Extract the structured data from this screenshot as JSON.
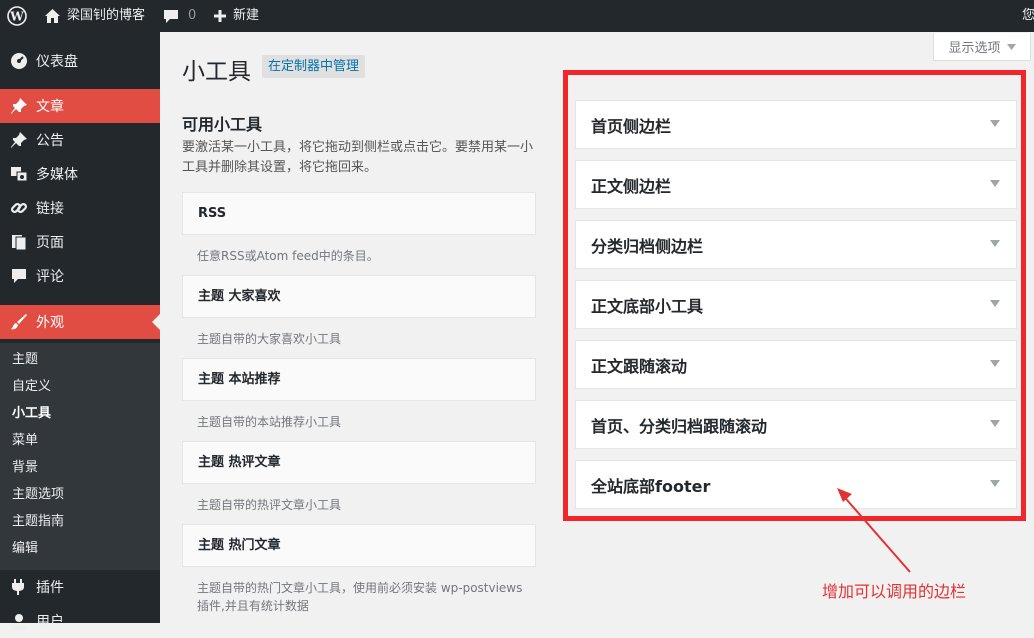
{
  "admin_bar": {
    "site_name": "梁国钊的博客",
    "comments_count": "0",
    "new_label": "新建",
    "user_partial": "您"
  },
  "sidebar": {
    "items": [
      {
        "label": "仪表盘",
        "icon": "dashboard-icon"
      },
      {
        "label": "文章",
        "icon": "pin-icon"
      },
      {
        "label": "公告",
        "icon": "pin-icon"
      },
      {
        "label": "多媒体",
        "icon": "media-icon"
      },
      {
        "label": "链接",
        "icon": "link-icon"
      },
      {
        "label": "页面",
        "icon": "pages-icon"
      },
      {
        "label": "评论",
        "icon": "comment-icon"
      },
      {
        "label": "外观",
        "icon": "brush-icon"
      }
    ],
    "submenu": [
      "主题",
      "自定义",
      "小工具",
      "菜单",
      "背景",
      "主题选项",
      "主题指南",
      "编辑"
    ],
    "after": [
      {
        "label": "插件",
        "icon": "plugin-icon"
      },
      {
        "label": "用户",
        "icon": "user-icon"
      }
    ]
  },
  "main": {
    "title": "小工具",
    "customizer_button": "在定制器中管理",
    "screen_options": "显示选项",
    "available_title": "可用小工具",
    "available_desc": "要激活某一小工具，将它拖动到侧栏或点击它。要禁用某一小工具并删除其设置，将它拖回来。",
    "widgets": [
      {
        "name": "RSS",
        "desc": "任意RSS或Atom feed中的条目。"
      },
      {
        "name": "主题  大家喜欢",
        "desc": "主题自带的大家喜欢小工具"
      },
      {
        "name": "主题  本站推荐",
        "desc": "主题自带的本站推荐小工具"
      },
      {
        "name": "主题  热评文章",
        "desc": "主题自带的热评文章小工具"
      },
      {
        "name": "主题  热门文章",
        "desc": "主题自带的热门文章小工具，使用前必须安装 wp-postviews 插件,并且有统计数据"
      }
    ],
    "sidebars": [
      "首页侧边栏",
      "正文侧边栏",
      "分类归档侧边栏",
      "正文底部小工具",
      "正文跟随滚动",
      "首页、分类归档跟随滚动",
      "全站底部footer"
    ]
  },
  "annotation": "增加可以调用的边栏",
  "colors": {
    "accent": "#e14d43",
    "frame": "#f0262a",
    "adminbar": "#23282d"
  }
}
